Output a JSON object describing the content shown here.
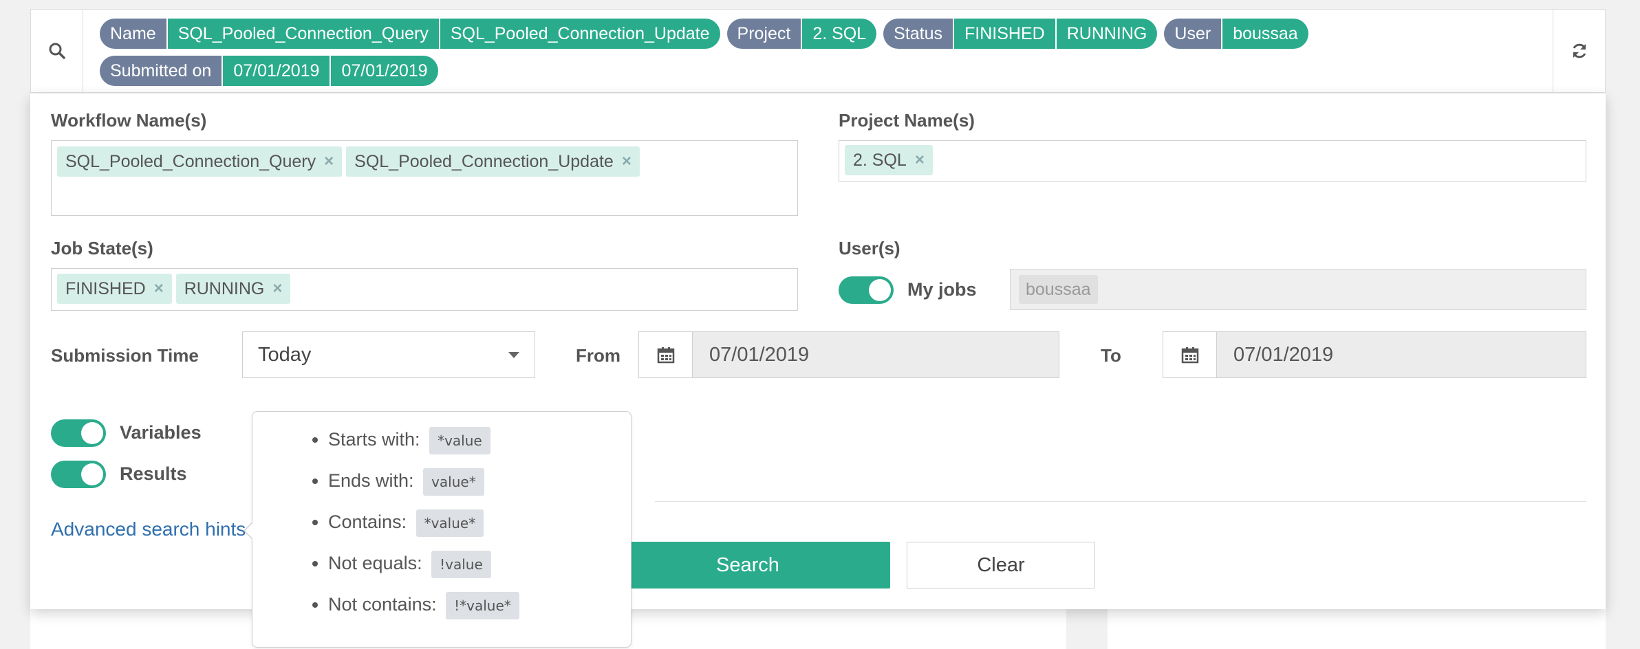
{
  "filters": {
    "search_icon": "search-icon",
    "refresh_icon": "refresh-icon",
    "row1": [
      {
        "key": "Name",
        "values": [
          "SQL_Pooled_Connection_Query",
          "SQL_Pooled_Connection_Update"
        ]
      },
      {
        "key": "Project",
        "values": [
          "2. SQL"
        ]
      },
      {
        "key": "Status",
        "values": [
          "FINISHED",
          "RUNNING"
        ]
      },
      {
        "key": "User",
        "values": [
          "boussaa"
        ]
      }
    ],
    "row2": [
      {
        "key": "Submitted on",
        "values": [
          "07/01/2019",
          "07/01/2019"
        ]
      }
    ]
  },
  "form": {
    "workflow_label": "Workflow Name(s)",
    "workflow_tags": [
      "SQL_Pooled_Connection_Query",
      "SQL_Pooled_Connection_Update"
    ],
    "project_label": "Project Name(s)",
    "project_tags": [
      "2. SQL"
    ],
    "jobstate_label": "Job State(s)",
    "jobstate_tags": [
      "FINISHED",
      "RUNNING"
    ],
    "users_label": "User(s)",
    "my_jobs_label": "My jobs",
    "user_value": "boussaa",
    "submission_label": "Submission Time",
    "submission_selected": "Today",
    "from_label": "From",
    "from_value": "07/01/2019",
    "to_label": "To",
    "to_value": "07/01/2019",
    "variables_label": "Variables",
    "results_label": "Results",
    "advanced_link": "Advanced search hints",
    "search_button": "Search",
    "clear_button": "Clear",
    "close_symbol": "×",
    "calendar_icon": "calendar-icon"
  },
  "hints": [
    {
      "label": "Starts with:",
      "code": "*value"
    },
    {
      "label": "Ends with:",
      "code": "value*"
    },
    {
      "label": "Contains:",
      "code": "*value*"
    },
    {
      "label": "Not equals:",
      "code": "!value"
    },
    {
      "label": "Not contains:",
      "code": "!*value*"
    }
  ],
  "colors": {
    "accent": "#2aac8c",
    "chip_key": "#6f7f9b",
    "link": "#2f6fae"
  }
}
